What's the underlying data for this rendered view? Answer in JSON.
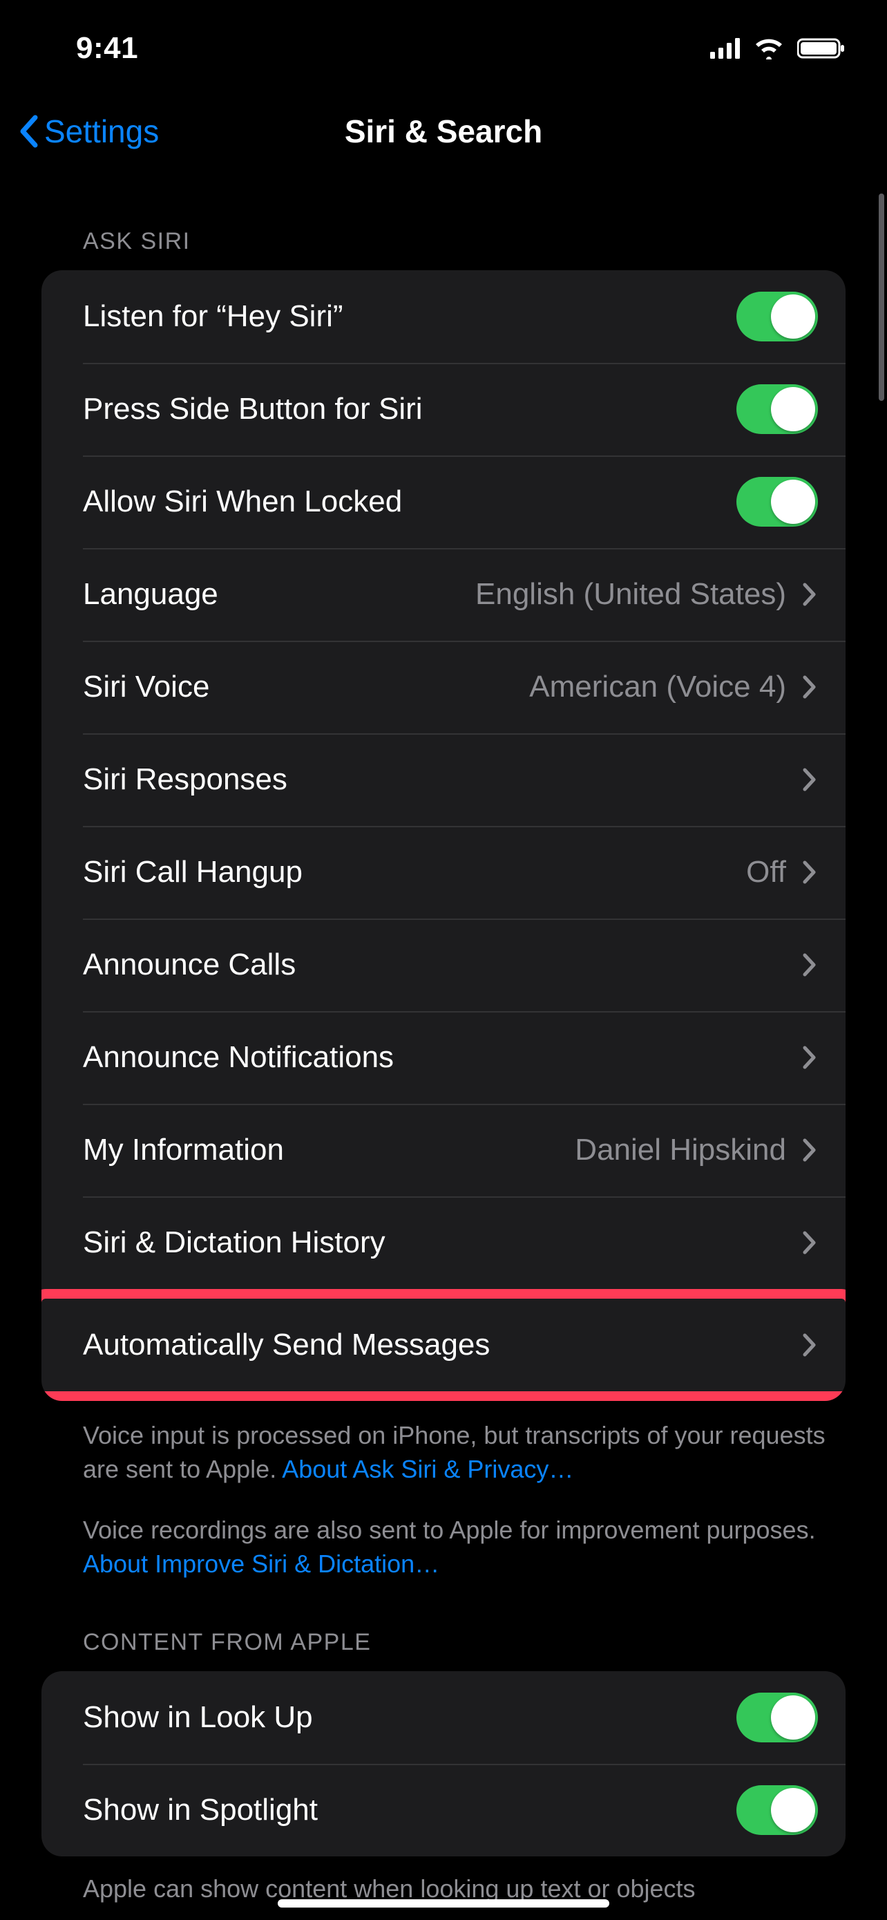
{
  "status": {
    "time": "9:41"
  },
  "nav": {
    "back_label": "Settings",
    "title": "Siri & Search"
  },
  "sections": {
    "ask_siri": {
      "header": "ASK SIRI",
      "rows": {
        "hey_siri": {
          "label": "Listen for “Hey Siri”",
          "on": true
        },
        "side_button": {
          "label": "Press Side Button for Siri",
          "on": true
        },
        "when_locked": {
          "label": "Allow Siri When Locked",
          "on": true
        },
        "language": {
          "label": "Language",
          "value": "English (United States)"
        },
        "voice": {
          "label": "Siri Voice",
          "value": "American (Voice 4)"
        },
        "responses": {
          "label": "Siri Responses"
        },
        "call_hangup": {
          "label": "Siri Call Hangup",
          "value": "Off"
        },
        "announce_calls": {
          "label": "Announce Calls"
        },
        "announce_notifs": {
          "label": "Announce Notifications"
        },
        "my_info": {
          "label": "My Information",
          "value": "Daniel Hipskind"
        },
        "history": {
          "label": "Siri & Dictation History"
        },
        "auto_send": {
          "label": "Automatically Send Messages"
        }
      },
      "footer": {
        "p1_text": "Voice input is processed on iPhone, but transcripts of your requests are sent to Apple. ",
        "p1_link": "About Ask Siri & Privacy…",
        "p2_text": "Voice recordings are also sent to Apple for improvement purposes. ",
        "p2_link": "About Improve Siri & Dictation…"
      }
    },
    "content_from_apple": {
      "header": "CONTENT FROM APPLE",
      "rows": {
        "look_up": {
          "label": "Show in Look Up",
          "on": true
        },
        "spotlight": {
          "label": "Show in Spotlight",
          "on": true
        }
      },
      "footer_truncated": "Apple can show content when looking up text or objects"
    }
  }
}
